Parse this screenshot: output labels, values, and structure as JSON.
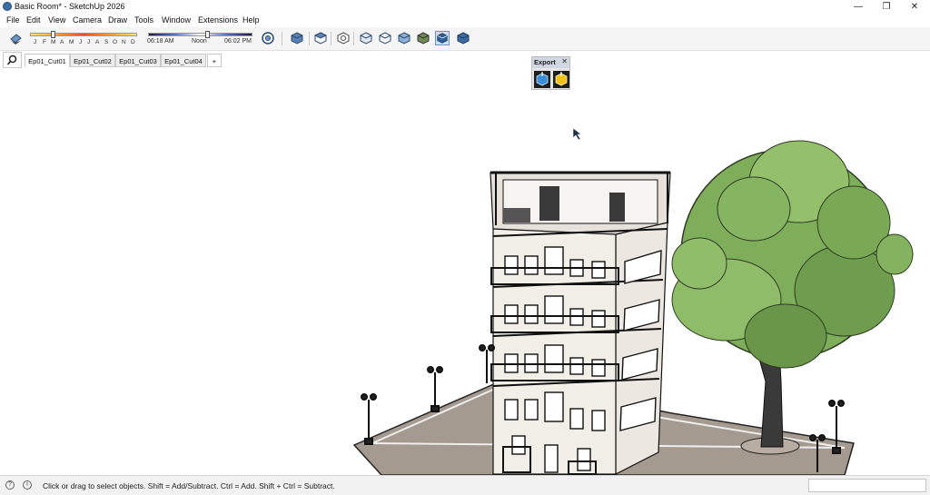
{
  "window": {
    "title": "Basic Room* - SketchUp 2026",
    "minimize": "—",
    "restore": "❐",
    "close": "✕"
  },
  "menu": [
    "File",
    "Edit",
    "View",
    "Camera",
    "Draw",
    "Tools",
    "Window",
    "Extensions",
    "Help"
  ],
  "shadow": {
    "months": [
      "J",
      "F",
      "M",
      "A",
      "M",
      "J",
      "J",
      "A",
      "S",
      "O",
      "N",
      "D"
    ],
    "time_start": "06:18 AM",
    "time_mid": "Noon",
    "time_end": "06:02 PM",
    "date_level": 0.22,
    "time_level": 0.57
  },
  "tabs": [
    "Ep01_Cut01",
    "Ep01_Cut02",
    "Ep01_Cut03",
    "Ep01_Cut04"
  ],
  "add_tab": "+",
  "export_panel": {
    "title": "Export",
    "close": "✕"
  },
  "status": {
    "text": "Click or drag to select objects. Shift = Add/Subtract. Ctrl = Add. Shift + Ctrl = Subtract.",
    "info_icon": "i",
    "help_icon": "?"
  },
  "colors": {
    "accent": "#3a6ea5",
    "foliage": "#7fae5a",
    "ground": "#a59a8f",
    "building": "#f2efe9"
  }
}
